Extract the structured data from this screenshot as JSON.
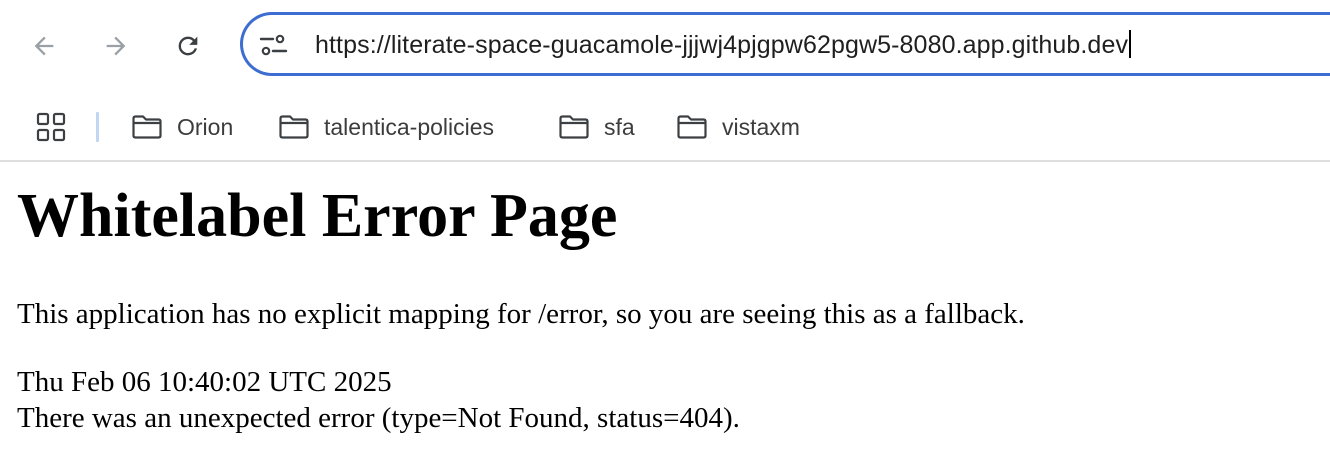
{
  "browser": {
    "address_bar": {
      "url": "https://literate-space-guacamole-jjjwj4pjgpw62pgw5-8080.app.github.dev"
    },
    "bookmarks": [
      {
        "label": "Orion"
      },
      {
        "label": "talentica-policies"
      },
      {
        "label": "sfa"
      },
      {
        "label": "vistaxm"
      }
    ],
    "colors": {
      "focus_ring": "#3d6dd0",
      "icon": "#5f6368",
      "icon_disabled": "#9aa0a6"
    }
  },
  "page": {
    "title": "Whitelabel Error Page",
    "message": "This application has no explicit mapping for /error, so you are seeing this as a fallback.",
    "timestamp": "Thu Feb 06 10:40:02 UTC 2025",
    "error_detail": "There was an unexpected error (type=Not Found, status=404)."
  }
}
